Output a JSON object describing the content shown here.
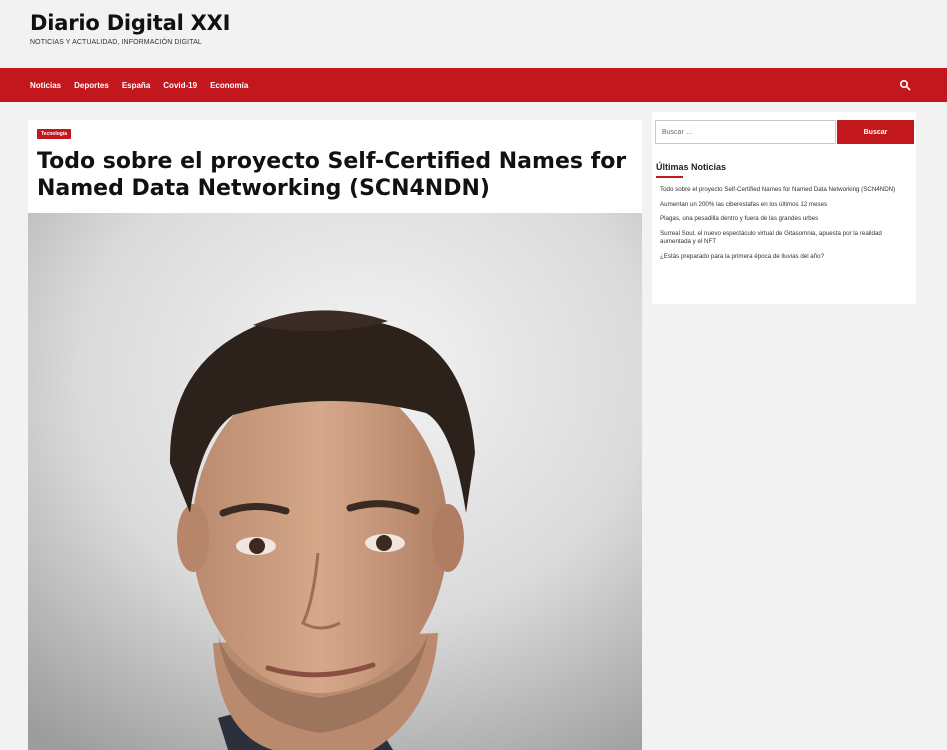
{
  "site": {
    "title": "Diario Digital XXI",
    "tagline": "NOTICIAS Y ACTUALIDAD, INFORMACIÓN DIGITAL"
  },
  "nav": {
    "items": [
      {
        "label": "Noticias"
      },
      {
        "label": "Deportes"
      },
      {
        "label": "España"
      },
      {
        "label": "Covid-19"
      },
      {
        "label": "Economía"
      }
    ],
    "search_icon": "search-icon"
  },
  "article": {
    "category": "Tecnología",
    "title": "Todo sobre el proyecto Self-Certified Names for Named Data Networking (SCN4NDN)"
  },
  "sidebar": {
    "search": {
      "placeholder": "Buscar …",
      "button_label": "Buscar"
    },
    "widget_title": "Últimas Noticias",
    "recent_posts": [
      {
        "label": "Todo sobre el proyecto Self-Certified Names for Named Data Networking (SCN4NDN)"
      },
      {
        "label": "Aumentan un 200% las ciberestafas en los últimos 12 meses"
      },
      {
        "label": "Plagas, una pesadilla dentro y fuera de las grandes urbes"
      },
      {
        "label": "Surreal Soul, el nuevo espectáculo virtual de Gitasomnia, apuesta por la realidad aumentada y el NFT"
      },
      {
        "label": "¿Estás preparado para la primera época de lluvias del año?"
      }
    ]
  },
  "colors": {
    "brand_red": "#c1171d",
    "page_bg": "#f2f2f2"
  }
}
